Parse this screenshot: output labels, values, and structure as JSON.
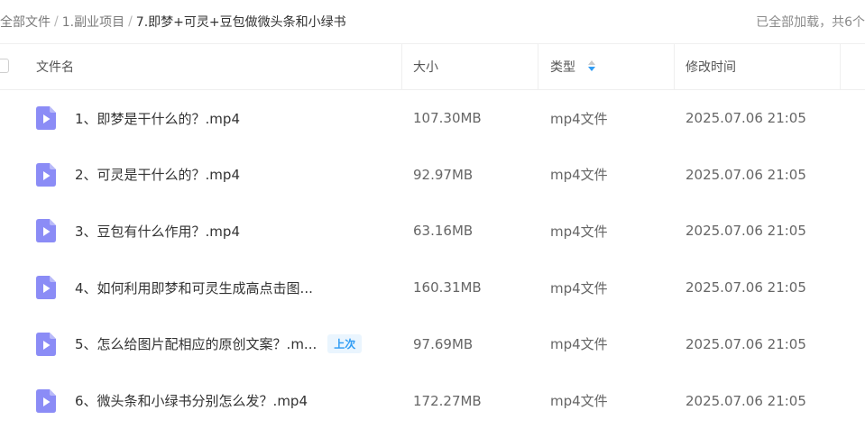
{
  "breadcrumb": {
    "items": [
      "全部文件",
      "1.副业项目",
      "7.即梦+可灵+豆包做微头条和小绿书"
    ],
    "separator": "/"
  },
  "load_status": "已全部加载，共6个",
  "table": {
    "columns": {
      "name": "文件名",
      "size": "大小",
      "type": "类型",
      "modified": "修改时间"
    },
    "rows": [
      {
        "name": "1、即梦是干什么的？.mp4",
        "size": "107.30MB",
        "type": "mp4文件",
        "modified": "2025.07.06 21:05",
        "badge": ""
      },
      {
        "name": "2、可灵是干什么的？.mp4",
        "size": "92.97MB",
        "type": "mp4文件",
        "modified": "2025.07.06 21:05",
        "badge": ""
      },
      {
        "name": "3、豆包有什么作用？.mp4",
        "size": "63.16MB",
        "type": "mp4文件",
        "modified": "2025.07.06 21:05",
        "badge": ""
      },
      {
        "name": "4、如何利用即梦和可灵生成高点击图...",
        "size": "160.31MB",
        "type": "mp4文件",
        "modified": "2025.07.06 21:05",
        "badge": ""
      },
      {
        "name": "5、怎么给图片配相应的原创文案？.m...",
        "size": "97.69MB",
        "type": "mp4文件",
        "modified": "2025.07.06 21:05",
        "badge": "上次"
      },
      {
        "name": "6、微头条和小绿书分别怎么发？.mp4",
        "size": "172.27MB",
        "type": "mp4文件",
        "modified": "2025.07.06 21:05",
        "badge": ""
      }
    ]
  },
  "colors": {
    "video_icon": "#8b8cf6",
    "accent": "#2f9cf4",
    "badge_bg": "#eaf5fe"
  },
  "icons": {
    "file": "video-file-icon",
    "sort": "sort-icon"
  }
}
